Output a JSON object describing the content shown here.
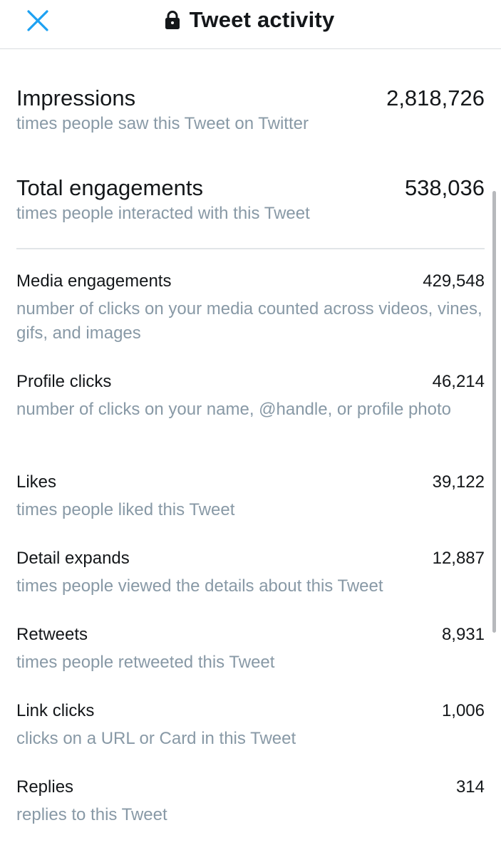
{
  "header": {
    "title": "Tweet activity"
  },
  "summary": [
    {
      "label": "Impressions",
      "value": "2,818,726",
      "desc": "times people saw this Tweet on Twitter"
    },
    {
      "label": "Total engagements",
      "value": "538,036",
      "desc": "times people interacted with this Tweet"
    }
  ],
  "metrics": [
    {
      "label": "Media engagements",
      "value": "429,548",
      "desc": "number of clicks on your media counted across videos, vines, gifs, and images"
    },
    {
      "label": "Profile clicks",
      "value": "46,214",
      "desc": "number of clicks on your name, @handle, or profile photo"
    },
    {
      "label": "Likes",
      "value": "39,122",
      "desc": "times people liked this Tweet"
    },
    {
      "label": "Detail expands",
      "value": "12,887",
      "desc": "times people viewed the details about this Tweet"
    },
    {
      "label": "Retweets",
      "value": "8,931",
      "desc": "times people retweeted this Tweet"
    },
    {
      "label": "Link clicks",
      "value": "1,006",
      "desc": "clicks on a URL or Card in this Tweet"
    },
    {
      "label": "Replies",
      "value": "314",
      "desc": "replies to this Tweet"
    }
  ],
  "colors": {
    "accent": "#1da1f2",
    "primary_text": "#14171a",
    "secondary_text": "#8899a6",
    "divider": "#e1e5e8"
  },
  "icons": {
    "close": "close-icon",
    "lock": "lock-icon"
  }
}
